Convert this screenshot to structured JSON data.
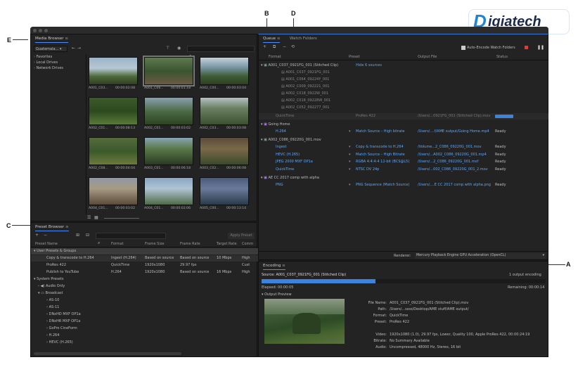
{
  "callouts": {
    "a": "A",
    "b": "B",
    "c": "C",
    "d": "D",
    "e": "E"
  },
  "logo": {
    "text": "igiatech",
    "letter": "D"
  },
  "media_browser": {
    "title": "Media Browser",
    "location": "Guatemala...",
    "tree": [
      "Favorites",
      "Local Drives",
      "Network Drives"
    ],
    "thumbs": [
      {
        "name": "A001_C03...",
        "time": "00:00:02:08"
      },
      {
        "name": "A001_C06...",
        "time": "00:00:01:18"
      },
      {
        "name": "A002_C00...",
        "time": "00:00:03:04"
      },
      {
        "name": "A002_C01...",
        "time": "00:00:08:13"
      },
      {
        "name": "A002_C01...",
        "time": "00:00:03:02"
      },
      {
        "name": "A002_C03...",
        "time": "00:00:03:08"
      },
      {
        "name": "A002_C08...",
        "time": "00:00:04:04"
      },
      {
        "name": "A003_C01...",
        "time": "00:00:06:18"
      },
      {
        "name": "A003_C02...",
        "time": "00:00:06:08"
      },
      {
        "name": "A004_C01...",
        "time": "00:00:03:02"
      },
      {
        "name": "A004_C01...",
        "time": "00:00:02:06"
      },
      {
        "name": "A005_C00...",
        "time": "00:00:13:14"
      }
    ]
  },
  "preset_browser": {
    "title": "Preset Browser",
    "apply": "Apply Preset",
    "columns": [
      "Preset Name",
      "Format",
      "Frame Size",
      "Frame Rate",
      "Target Rate",
      "Comm"
    ],
    "user_group": "User Presets & Groups",
    "user_rows": [
      [
        "Copy & transcode to H.264",
        "Ingest (H.264)",
        "Based on source",
        "Based on source",
        "10 Mbps",
        "High"
      ],
      [
        "ProRes 422",
        "QuickTime",
        "1920x1080",
        "29.97 fps",
        "",
        "Cust"
      ],
      [
        "Publish to YouTube",
        "H.264",
        "1920x1080",
        "Based on source",
        "16 Mbps",
        "High"
      ]
    ],
    "system_group": "System Presets",
    "system_items": [
      "Audio Only",
      "Broadcast",
      "AS-10",
      "AS-11",
      "DNxHD MXF OP1a",
      "DNxHR MXF OP1a",
      "GoPro CineForm",
      "H.264",
      "HEVC (H.265)"
    ]
  },
  "queue": {
    "tab": "Queue",
    "tab2": "Watch Folders",
    "auto_encode": "Auto-Encode Watch Folders",
    "columns": [
      "Format",
      "Preset",
      "Output File",
      "Status"
    ],
    "group1": {
      "name": "A001_C037_0921FG_001 (Stitched Clip)",
      "hide": "Hide 6 sources",
      "sources": [
        "A001_C037_0921FG_001",
        "A001_C064_09224Y_001",
        "A002_C009_092221_001",
        "A002_C018_0922W_001",
        "A002_C018_09228W_001",
        "A002_C052_092277_001"
      ],
      "format": "QuickTime",
      "preset": "ProRes 422",
      "output": "/Users/...0921FG_001 (Stitched Clip).mov"
    },
    "group2": {
      "name": "Going Home",
      "format": "H.264",
      "preset": "Match Source – High bitrate",
      "output": "/Users/....f/AME output/Going Home.mp4",
      "status": "Ready"
    },
    "group3": {
      "name": "A002_C086_09220G_001.mov",
      "rows": [
        {
          "format": "Ingest",
          "preset": "Copy & transcode to H.264",
          "output": "/Volume...2_C086_09220G_001.mov",
          "status": "Ready"
        },
        {
          "format": "HEVC (H.265)",
          "preset": "Match Source – High Bitrate",
          "output": "/Users/...A002_C086_09220G_001.mp4",
          "status": "Ready"
        },
        {
          "format": "JPEG 2000 MXF OP1a",
          "preset": "RGBA 4:4:4:4 12-bit (BCS@L5)",
          "output": "/Users/...2_C086_09220G_001.mxf",
          "status": "Ready"
        },
        {
          "format": "QuickTime",
          "preset": "NTSC DV 24p",
          "output": "/Users/...002_C086_09220G_001_2.mov",
          "status": "Ready"
        }
      ]
    },
    "group4": {
      "name": "AE CC 2017 comp with alpha",
      "format": "PNG",
      "preset": "PNG Sequence (Match Source)",
      "output": "/Users/....E CC 2017 comp with alpha.png",
      "status": "Ready"
    },
    "renderer_label": "Renderer:",
    "renderer_value": "Mercury Playback Engine GPU Acceleration (OpenCL)"
  },
  "encoding": {
    "title": "Encoding",
    "source": "Source: A001_C037_0921FG_001 (Stitched Clip)",
    "count": "1 output encoding",
    "elapsed": "Elapsed: 00:00:05",
    "remaining": "Remaining: 00:00:14",
    "progress": 0.4,
    "preview_label": "Output Preview",
    "info": [
      [
        "File Name:",
        "A001_C037_0921FG_001 (Stitched Clip).mov"
      ],
      [
        "Path:",
        "/Users/...ssss/Desktop/AME stuff/AME output/"
      ],
      [
        "Format:",
        "QuickTime"
      ],
      [
        "Preset:",
        "ProRes 422"
      ],
      [
        "Video:",
        "1920x1080 (1.0), 29.97 fps, Lower, Quality 100, Apple ProRes 422, 00:00:24:19"
      ],
      [
        "Bitrate:",
        "No Summary Available"
      ],
      [
        "Audio:",
        "Uncompressed, 48000 Hz, Stereo, 16 bit"
      ]
    ]
  }
}
